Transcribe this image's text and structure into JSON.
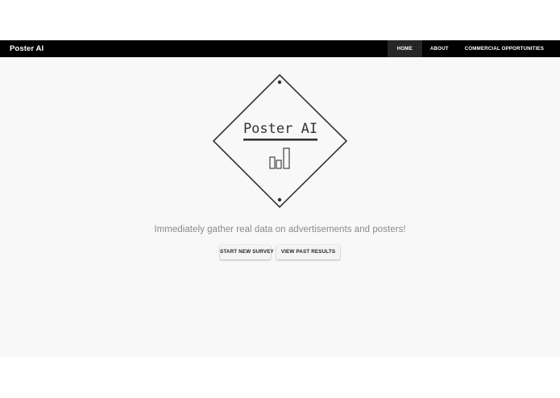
{
  "navbar": {
    "brand": "Poster AI",
    "links": [
      {
        "label": "HOME",
        "active": true
      },
      {
        "label": "ABOUT",
        "active": false
      },
      {
        "label": "COMMERCIAL OPPORTUNITIES",
        "active": false
      }
    ]
  },
  "hero": {
    "logo_text": "Poster AI",
    "logo_icon": "bar-chart-icon",
    "tagline": "Immediately gather real data on advertisements and posters!",
    "buttons": {
      "start_label": "START NEW SURVEY",
      "past_label": "VIEW PAST RESULTS"
    }
  },
  "colors": {
    "navbar_bg": "#000000",
    "active_tab_bg": "#262626",
    "page_bg": "#f8f8f8",
    "logo_stroke": "#333333",
    "tagline": "#8a8a8a"
  }
}
